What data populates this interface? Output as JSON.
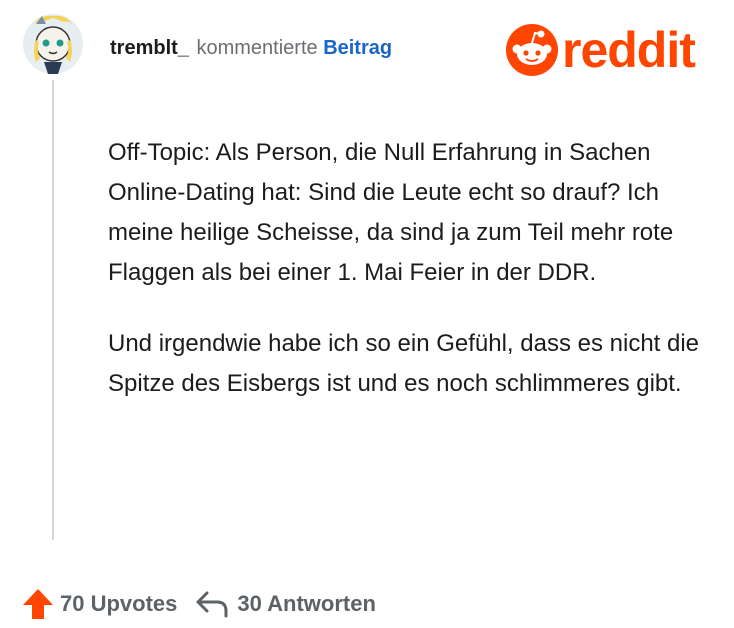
{
  "comment": {
    "username": "tremblt_",
    "action": "kommentierte",
    "target": "Beitrag",
    "paragraphs": [
      "Off-Topic: Als Person, die Null Erfahrung in Sachen Online-Dating hat: Sind die Leute echt so drauf? Ich meine heilige Scheisse, da sind ja zum Teil mehr rote Flaggen als bei einer 1. Mai Feier in der DDR.",
      "Und irgendwie habe ich so ein Gefühl, dass es nicht die Spitze des Eisbergs ist und es noch schlimmeres gibt."
    ]
  },
  "brand": {
    "logo_text": "reddit",
    "accent": "#ff4500"
  },
  "footer": {
    "upvotes": "70 Upvotes",
    "replies": "30 Antworten",
    "upvote_color": "#ff4500"
  },
  "icons": [
    "avatar",
    "reddit-snoo-icon",
    "upvote-arrow-icon",
    "reply-arrow-icon"
  ]
}
